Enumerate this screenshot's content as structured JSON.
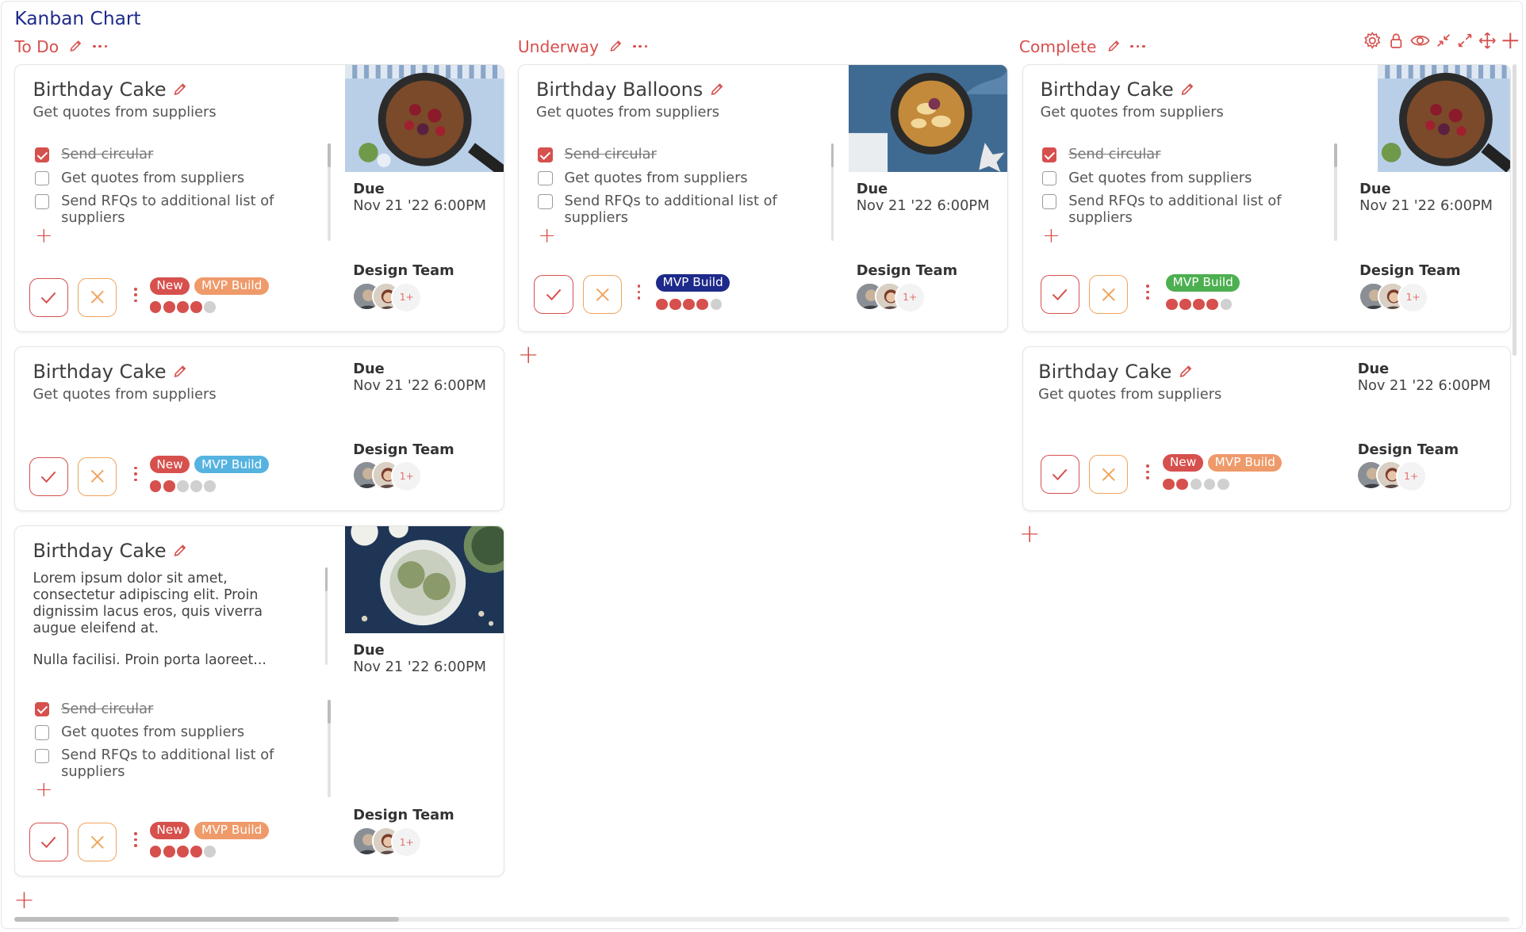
{
  "app": {
    "title": "Kanban Chart"
  },
  "colors": {
    "accent": "#d6504d",
    "title": "#1d2a8a",
    "reject": "#f0a45c"
  },
  "toolbar": {
    "icons": [
      "gear-icon",
      "lock-icon",
      "eye-icon",
      "collapse-icon",
      "expand-icon",
      "move-icon",
      "add-icon"
    ]
  },
  "columns": [
    {
      "name": "To Do",
      "cards": [
        {
          "title": "Birthday Cake",
          "subtitle": "Get quotes from suppliers",
          "checklist": [
            {
              "text": "Send circular",
              "done": true
            },
            {
              "text": "Get quotes from suppliers",
              "done": false
            },
            {
              "text": "Send RFQs to additional list of suppliers",
              "done": false
            }
          ],
          "due_label": "Due",
          "due": "Nov 21 '22 6:00PM",
          "team": "Design Team",
          "more": "1+",
          "tags": [
            {
              "label": "New",
              "color": "#d6504d"
            },
            {
              "label": "MVP Build",
              "color": "#ef9a6a"
            }
          ],
          "progress": 4,
          "progress_total": 5
        },
        {
          "title": "Birthday Cake",
          "subtitle": "Get quotes from suppliers",
          "due_label": "Due",
          "due": "Nov 21 '22 6:00PM",
          "team": "Design Team",
          "more": "1+",
          "tags": [
            {
              "label": "New",
              "color": "#d6504d"
            },
            {
              "label": "MVP Build",
              "color": "#56b3e0"
            }
          ],
          "progress": 2,
          "progress_total": 5
        },
        {
          "title": "Birthday Cake",
          "body": [
            "Lorem ipsum dolor sit amet, consectetur adipiscing elit. Proin dignissim lacus eros, quis viverra augue eleifend at.",
            "Nulla facilisi. Proin porta laoreet..."
          ],
          "checklist": [
            {
              "text": "Send circular",
              "done": true
            },
            {
              "text": "Get quotes from suppliers",
              "done": false
            },
            {
              "text": "Send RFQs to additional list of suppliers",
              "done": false
            }
          ],
          "due_label": "Due",
          "due": "Nov 21 '22 6:00PM",
          "team": "Design Team",
          "more": "1+",
          "tags": [
            {
              "label": "New",
              "color": "#d6504d"
            },
            {
              "label": "MVP Build",
              "color": "#ef9a6a"
            }
          ],
          "progress": 4,
          "progress_total": 5
        }
      ]
    },
    {
      "name": "Underway",
      "cards": [
        {
          "title": "Birthday Balloons",
          "subtitle": "Get quotes from suppliers",
          "checklist": [
            {
              "text": "Send circular",
              "done": true
            },
            {
              "text": "Get quotes from suppliers",
              "done": false
            },
            {
              "text": "Send RFQs to additional list of suppliers",
              "done": false
            }
          ],
          "due_label": "Due",
          "due": "Nov 21 '22 6:00PM",
          "team": "Design Team",
          "more": "1+",
          "tags": [
            {
              "label": "MVP Build",
              "color": "#1d2a8a"
            }
          ],
          "progress": 4,
          "progress_total": 5
        }
      ]
    },
    {
      "name": "Complete",
      "cards": [
        {
          "title": "Birthday Cake",
          "subtitle": "Get quotes from suppliers",
          "checklist": [
            {
              "text": "Send circular",
              "done": true
            },
            {
              "text": "Get quotes from suppliers",
              "done": false
            },
            {
              "text": "Send RFQs to additional list of suppliers",
              "done": false
            }
          ],
          "due_label": "Due",
          "due": "Nov 21 '22 6:00PM",
          "team": "Design Team",
          "more": "1+",
          "tags": [
            {
              "label": "MVP Build",
              "color": "#4caf50"
            }
          ],
          "progress": 4,
          "progress_total": 5
        },
        {
          "title": "Birthday Cake",
          "subtitle": "Get quotes from suppliers",
          "due_label": "Due",
          "due": "Nov 21 '22 6:00PM",
          "team": "Design Team",
          "more": "1+",
          "tags": [
            {
              "label": "New",
              "color": "#d6504d"
            },
            {
              "label": "MVP Build",
              "color": "#ef9a6a"
            }
          ],
          "progress": 2,
          "progress_total": 5
        }
      ]
    }
  ]
}
